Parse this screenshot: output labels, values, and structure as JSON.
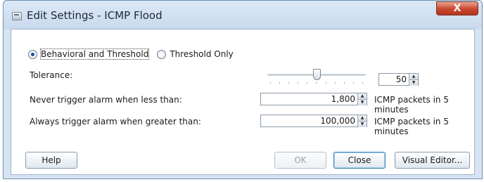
{
  "window": {
    "title": "Edit Settings - ICMP Flood",
    "close_label": "X"
  },
  "mode": {
    "options": [
      {
        "label": "Behavioral and Threshold",
        "selected": true
      },
      {
        "label": "Threshold Only",
        "selected": false
      }
    ]
  },
  "tolerance": {
    "label": "Tolerance:",
    "slider_value": 50,
    "slider_min": 0,
    "slider_max": 100,
    "value": "50"
  },
  "thresholds": [
    {
      "label": "Never trigger alarm when less than:",
      "value": "1,800",
      "unit": "ICMP packets in 5 minutes"
    },
    {
      "label": "Always trigger alarm when greater than:",
      "value": "100,000",
      "unit": "ICMP packets in 5 minutes"
    }
  ],
  "buttons": {
    "help": "Help",
    "ok": "OK",
    "close": "Close",
    "visual_editor": "Visual Editor..."
  },
  "colors": {
    "accent": "#1b4f9c",
    "title_close": "#c9462e"
  }
}
